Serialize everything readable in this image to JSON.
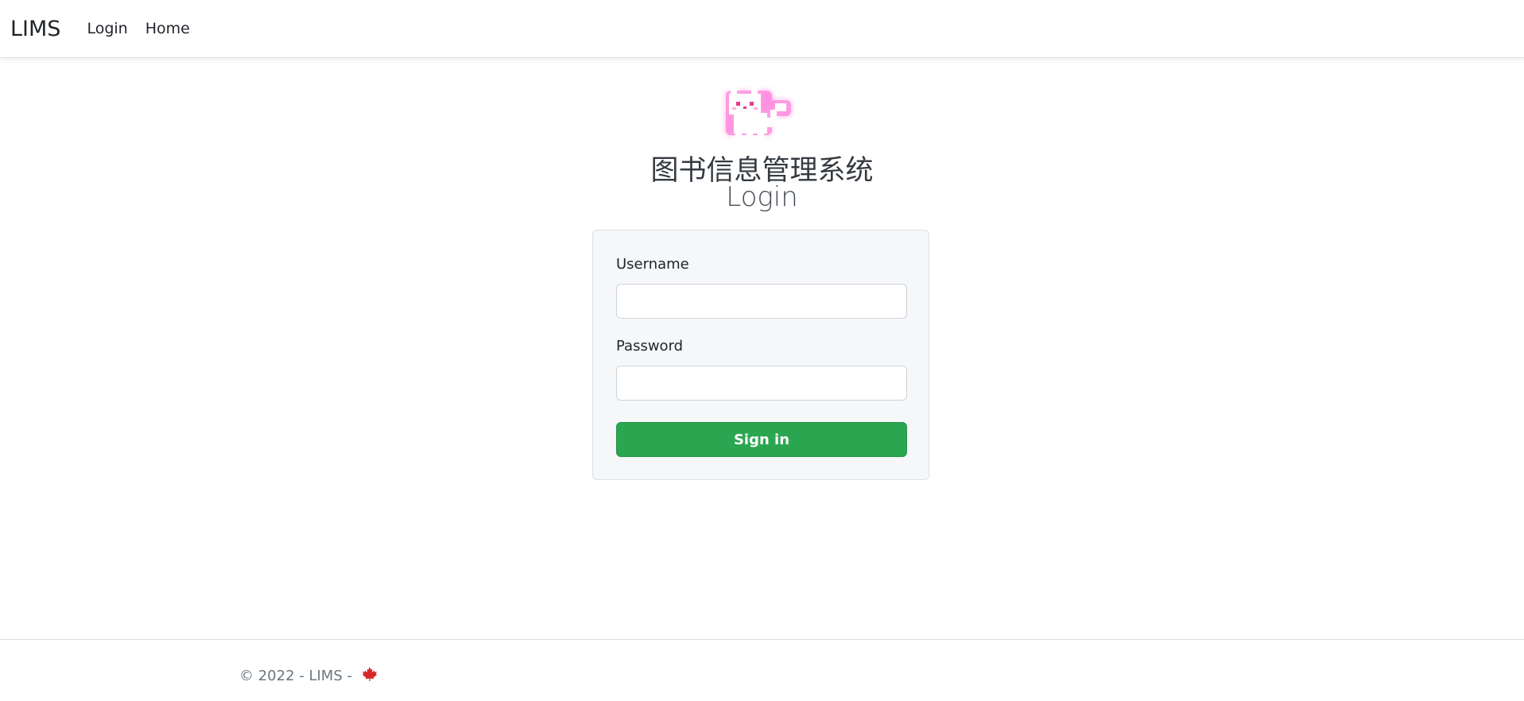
{
  "navbar": {
    "brand": "LIMS",
    "links": [
      {
        "label": "Login"
      },
      {
        "label": "Home"
      }
    ]
  },
  "header": {
    "system_title": "图书信息管理系统",
    "page_title": "Login"
  },
  "form": {
    "username_label": "Username",
    "username_value": "",
    "password_label": "Password",
    "password_value": "",
    "submit_label": "Sign in"
  },
  "footer": {
    "text": "© 2022 - LIMS -",
    "icon": "maple-leaf-icon"
  },
  "colors": {
    "accent": "#2ba650",
    "leaf": "#d62828",
    "mascot_glow": "#ff7ad9"
  }
}
